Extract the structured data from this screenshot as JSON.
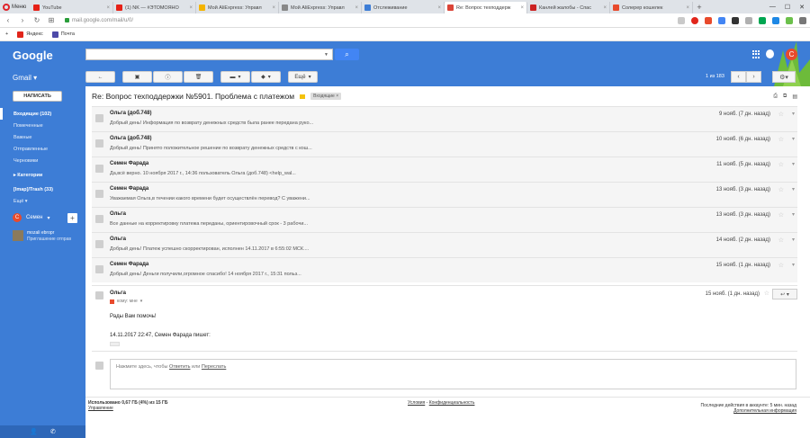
{
  "browser": {
    "menu_label": "Меню",
    "tabs": [
      {
        "title": "YouTube",
        "color": "#e62117"
      },
      {
        "title": "(1) NK — #ЭТОМОЯНО",
        "color": "#e62117"
      },
      {
        "title": "Мой AliExpress: Управл",
        "color": "#f4b400"
      },
      {
        "title": "Мой AliExpress: Управл",
        "color": "#888888"
      },
      {
        "title": "Отслеживание",
        "color": "#3d7dd6"
      },
      {
        "title": "Re: Вопрос техподдерж",
        "color": "#db4437",
        "active": true
      },
      {
        "title": "Канлей жалобы - Спас",
        "color": "#cc2222"
      },
      {
        "title": "Солерер кошелек",
        "color": "#e84a2c"
      }
    ],
    "url": "mail.google.com/mail/u/0/",
    "bookmarks": [
      "Яндекс",
      "Почта"
    ]
  },
  "header": {
    "logo": "Google",
    "app_label": "Gmail",
    "avatar_letter": "С",
    "pager": "1 из 183",
    "toolbar": {
      "more_label": "Ещё"
    }
  },
  "sidebar": {
    "compose_label": "НАПИСАТЬ",
    "items": [
      {
        "label": "Входящие (102)",
        "active": true
      },
      {
        "label": "Помеченные"
      },
      {
        "label": "Важные"
      },
      {
        "label": "Отправленные"
      },
      {
        "label": "Черновики"
      }
    ],
    "categories_label": "Категории",
    "trash_label": "[Imap]/Trash (33)",
    "more_label": "Ещё",
    "hangouts_user": "Семен",
    "contact_name": "mozali ebropr",
    "contact_status": "Приглашение отправ"
  },
  "thread": {
    "subject": "Re: Вопрос техподдержки №5901. Проблема с платежом",
    "label": "Входящие",
    "messages": [
      {
        "sender": "Ольга (доб.748)",
        "snippet": "Добрый день! Информация по возврату денежных средств была ранее передана руко...",
        "date": "9 нояб. (7 дн. назад)"
      },
      {
        "sender": "Ольга (доб.748)",
        "snippet": "Добрый день! Принято положительное решение по возврату денежных средств с кош...",
        "date": "10 нояб. (6 дн. назад)"
      },
      {
        "sender": "Семен Фарада",
        "snippet": "Да,всё верно. 10 ноября 2017 г., 14:36 пользователь Ольга (доб.748) <help_wal...",
        "date": "11 нояб. (5 дн. назад)"
      },
      {
        "sender": "Семен Фарада",
        "snippet": "Уважаемая Ольга,в течении какого времени будет осуществлён перевод? С уважени...",
        "date": "13 нояб. (3 дн. назад)"
      },
      {
        "sender": "Ольга",
        "snippet": "Все данные на корректировку платежа переданы, ориентировочный срок - 3 рабочи...",
        "date": "13 нояб. (3 дн. назад)"
      },
      {
        "sender": "Ольга",
        "snippet": "Добрый день! Платеж успешно скорректирован, исполнен 14.11.2017 в 6:55:02 МСК....",
        "date": "14 нояб. (2 дн. назад)"
      },
      {
        "sender": "Семен Фарада",
        "snippet": "Добрый день! Деньги получили,огромное спасибо! 14 ноября 2017 г., 15:31 польз...",
        "date": "15 нояб. (1 дн. назад)"
      }
    ],
    "expanded": {
      "sender": "Ольга",
      "to_label": "кому: мне",
      "date": "15 нояб. (1 дн. назад)",
      "body_line1": "Рады Вам помочь!",
      "body_line2": "14.11.2017 22:47, Семен Фарада пишет:"
    },
    "reply_placeholder_prefix": "Нажмите здесь, чтобы",
    "reply_link": "Ответить",
    "reply_or": "или",
    "forward_link": "Переслать"
  },
  "footer": {
    "usage": "Использовано 0,67 ГБ (4%) из 15 ГБ",
    "manage": "Управление",
    "terms": "Условия",
    "separator": "-",
    "privacy": "Конфиденциальность",
    "last_activity": "Последние действия в аккаунте: 5 мин. назад",
    "details": "Дополнительная информация"
  }
}
